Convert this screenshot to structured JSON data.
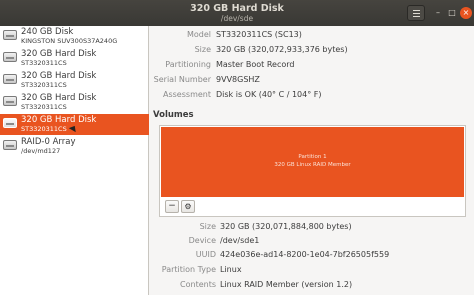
{
  "window": {
    "title": "320 GB Hard Disk",
    "subtitle": "/dev/sde",
    "close_glyph": "×",
    "minimize_glyph": "–",
    "maximize_glyph": "□"
  },
  "sidebar": {
    "items": [
      {
        "name": "240 GB Disk",
        "sub": "KINGSTON SUV300S37A240G",
        "icon": "harddisk-icon"
      },
      {
        "name": "320 GB Hard Disk",
        "sub": "ST3320311CS",
        "icon": "harddisk-icon"
      },
      {
        "name": "320 GB Hard Disk",
        "sub": "ST3320311CS",
        "icon": "harddisk-icon"
      },
      {
        "name": "320 GB Hard Disk",
        "sub": "ST3320311CS",
        "icon": "harddisk-icon"
      },
      {
        "name": "320 GB Hard Disk",
        "sub": "ST3320311CS",
        "icon": "harddisk-icon",
        "selected": true
      },
      {
        "name": "RAID-0 Array",
        "sub": "/dev/md127",
        "icon": "raid-icon"
      }
    ]
  },
  "details": {
    "model_label": "Model",
    "model_value": "ST3320311CS (SC13)",
    "size_label": "Size",
    "size_value": "320 GB (320,072,933,376 bytes)",
    "partitioning_label": "Partitioning",
    "partitioning_value": "Master Boot Record",
    "serial_label": "Serial Number",
    "serial_value": "9VV8GSHZ",
    "assessment_label": "Assessment",
    "assessment_value": "Disk is OK (40° C / 104° F)"
  },
  "volumes": {
    "title": "Volumes",
    "partition_name": "Partition 1",
    "partition_desc": "320 GB Linux RAID Member",
    "minus_glyph": "−",
    "gear_glyph": "⚙"
  },
  "volume_details": {
    "size_label": "Size",
    "size_value": "320 GB (320,071,884,800 bytes)",
    "device_label": "Device",
    "device_value": "/dev/sde1",
    "uuid_label": "UUID",
    "uuid_value": "424e036e-ad14-8200-1e04-7bf26505f559",
    "type_label": "Partition Type",
    "type_value": "Linux",
    "contents_label": "Contents",
    "contents_value": "Linux RAID Member (version 1.2)"
  },
  "colors": {
    "accent": "#e95420",
    "titlebar": "#3c3b37"
  }
}
